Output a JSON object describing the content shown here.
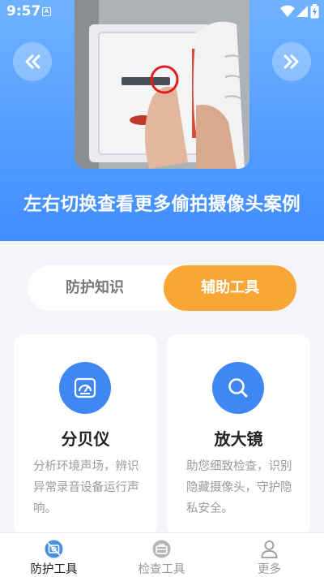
{
  "status_bar": {
    "time": "9:57",
    "app_icon_letter": "A"
  },
  "hero": {
    "caption": "左右切换查看更多偷拍摄像头案例",
    "prev_icon": "double-chevron-left-icon",
    "next_icon": "double-chevron-right-icon"
  },
  "segment": {
    "tabs": [
      {
        "label": "防护知识"
      },
      {
        "label": "辅助工具"
      }
    ],
    "selected": 1
  },
  "cards": [
    {
      "title": "分贝仪",
      "description": "分析环境声场，辨识异常录音设备运行声响。",
      "icon": "speedometer-icon"
    },
    {
      "title": "放大镜",
      "description": "助您细致检查，识别隐藏摄像头，守护隐私安全。",
      "icon": "magnifier-icon"
    }
  ],
  "bottom_nav": {
    "items": [
      {
        "label": "防护工具",
        "icon": "shield-camera-icon"
      },
      {
        "label": "检查工具",
        "icon": "toolbox-icon"
      },
      {
        "label": "更多",
        "icon": "user-icon"
      }
    ],
    "active": 0
  },
  "colors": {
    "hero_top": "#6fb3ff",
    "hero_bottom": "#3f8cff",
    "accent_orange": "#f8a736",
    "accent_blue": "#3f87f2",
    "active_nav": "#222222",
    "inactive_nav": "#9a9a9a"
  }
}
